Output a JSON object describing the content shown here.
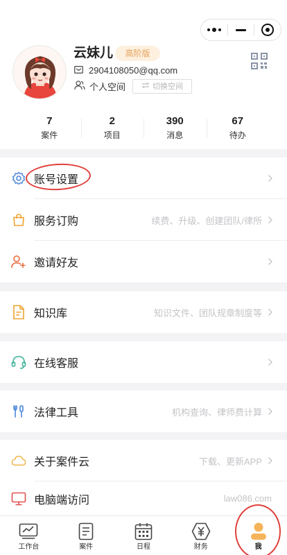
{
  "header": {
    "name": "云妹儿",
    "badge": "高阶版",
    "email": "2904108050@qq.com",
    "space": "个人空间",
    "switch_label": "切换空间"
  },
  "stats": [
    {
      "value": "7",
      "label": "案件"
    },
    {
      "value": "2",
      "label": "项目"
    },
    {
      "value": "390",
      "label": "消息"
    },
    {
      "value": "67",
      "label": "待办"
    }
  ],
  "menu": [
    {
      "id": "account-settings",
      "label": "账号设置",
      "hint": "",
      "icon": "gear-icon",
      "color": "#4a86d8"
    },
    {
      "id": "service-purchase",
      "label": "服务订购",
      "hint": "续费、升级、创建团队/律所",
      "icon": "shopping-bag-icon",
      "color": "#f0a22e"
    },
    {
      "id": "invite-friends",
      "label": "邀请好友",
      "hint": "",
      "icon": "add-user-icon",
      "color": "#ec6a3b"
    },
    {
      "id": "knowledge-base",
      "label": "知识库",
      "hint": "知识文件、团队规章制度等",
      "icon": "document-icon",
      "color": "#f0a22e"
    },
    {
      "id": "online-support",
      "label": "在线客服",
      "hint": "",
      "icon": "headset-icon",
      "color": "#3db39a"
    },
    {
      "id": "legal-tools",
      "label": "法律工具",
      "hint": "机构查询、律师费计算",
      "icon": "tools-icon",
      "color": "#4a86d8"
    },
    {
      "id": "about",
      "label": "关于案件云",
      "hint": "下载、更新APP",
      "icon": "cloud-icon",
      "color": "#f0b54a"
    },
    {
      "id": "desktop-access",
      "label": "电脑端访问",
      "hint": "law086.com",
      "icon": "monitor-icon",
      "color": "#e05050"
    }
  ],
  "tabs": [
    {
      "id": "workbench",
      "label": "工作台",
      "icon": "chart-icon"
    },
    {
      "id": "cases",
      "label": "案件",
      "icon": "document-icon"
    },
    {
      "id": "schedule",
      "label": "日程",
      "icon": "calendar-icon"
    },
    {
      "id": "finance",
      "label": "财务",
      "icon": "yuan-icon"
    },
    {
      "id": "me",
      "label": "我",
      "icon": "user-icon"
    }
  ],
  "active_tab": "me"
}
